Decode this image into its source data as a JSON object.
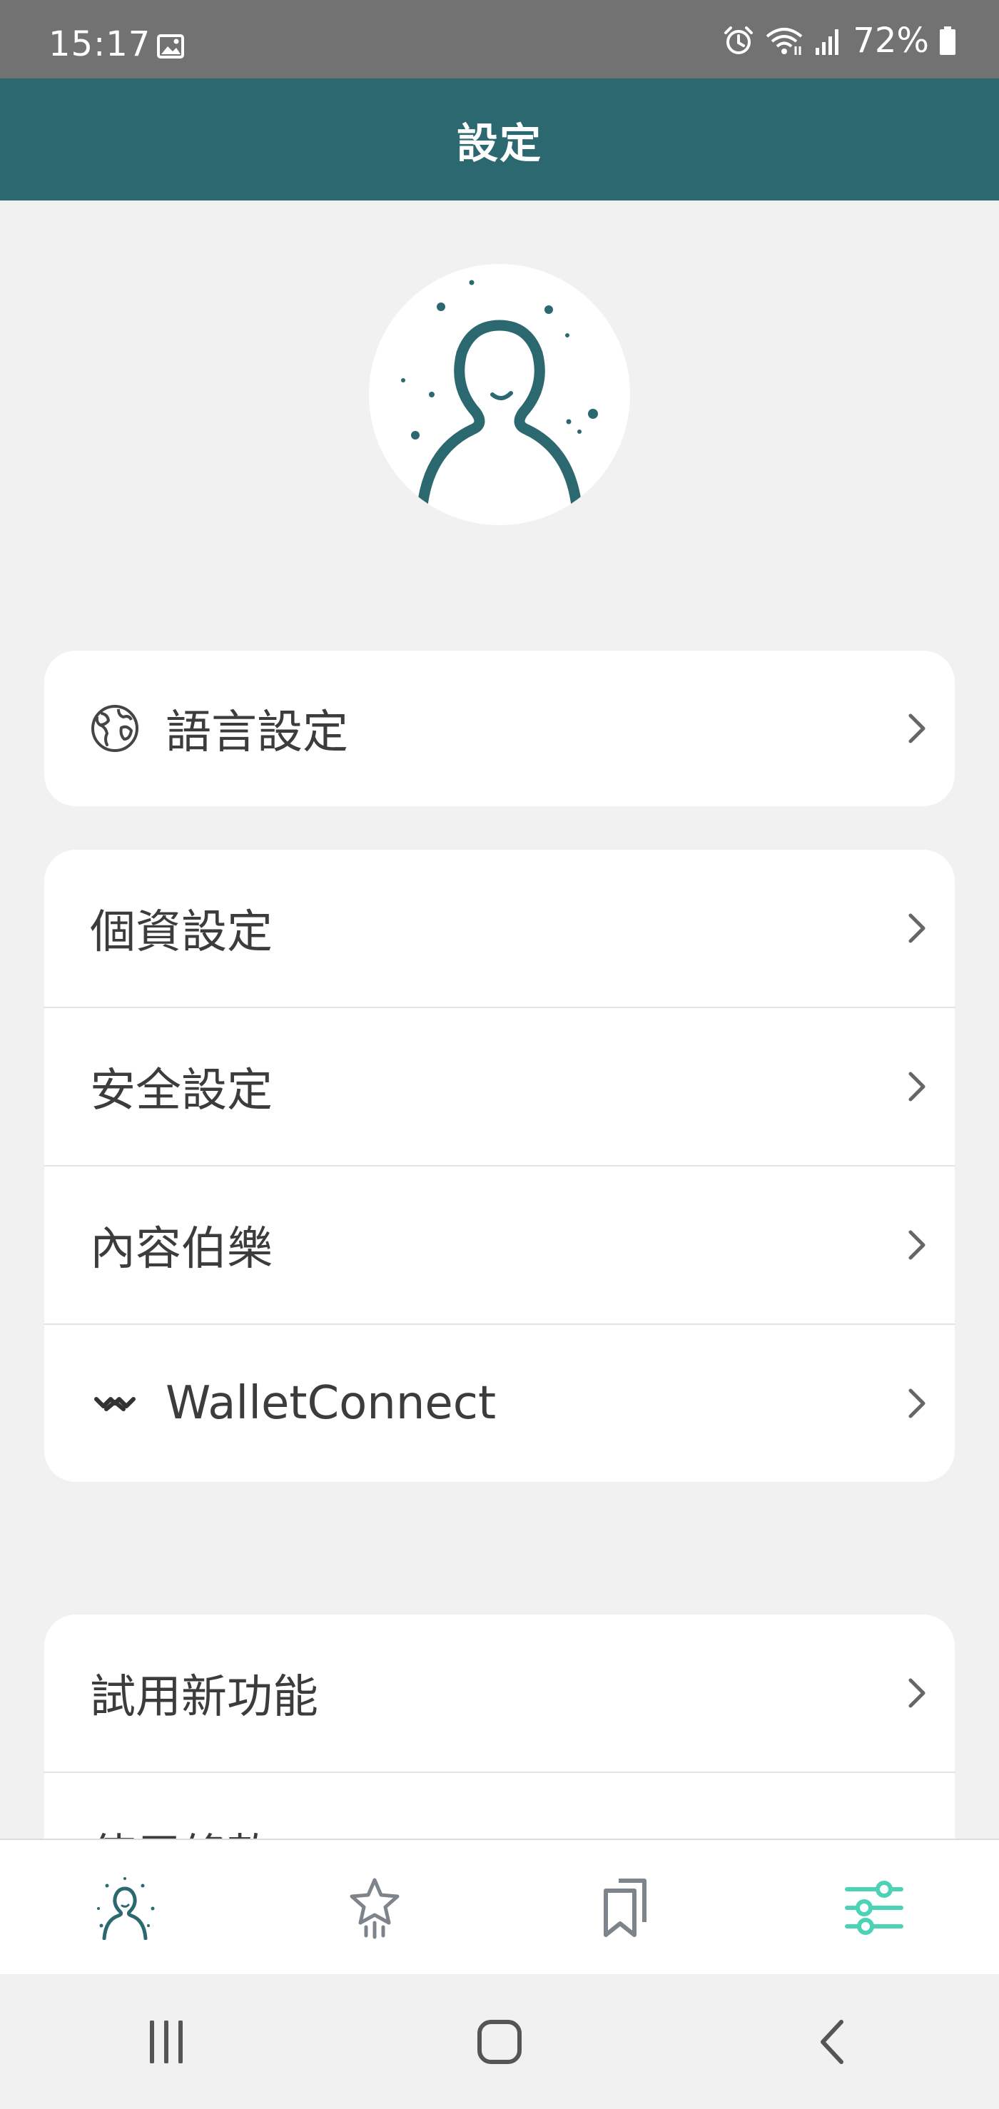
{
  "status_bar": {
    "time": "15:17",
    "battery": "72%",
    "icons": [
      "gallery-icon",
      "alarm-icon",
      "wifi-icon",
      "signal-icon",
      "battery-icon"
    ]
  },
  "header": {
    "title": "設定"
  },
  "settings": {
    "language": {
      "label": "語言設定",
      "icon": "globe-icon"
    },
    "group_account": [
      {
        "label": "個資設定"
      },
      {
        "label": "安全設定"
      },
      {
        "label": "內容伯樂"
      },
      {
        "label": "WalletConnect",
        "icon": "walletconnect-icon"
      }
    ],
    "group_more": [
      {
        "label": "試用新功能"
      },
      {
        "label": "使用條款"
      }
    ]
  },
  "bottom_nav": {
    "items": [
      {
        "name": "profile",
        "icon": "person-icon",
        "active": false
      },
      {
        "name": "favorites",
        "icon": "star-icon",
        "active": false
      },
      {
        "name": "bookmarks",
        "icon": "bookmarks-icon",
        "active": false
      },
      {
        "name": "settings",
        "icon": "sliders-icon",
        "active": true
      }
    ]
  },
  "colors": {
    "header_bg": "#2b6870",
    "accent_teal": "#4cd3b6",
    "icon_gray": "#7d848b",
    "avatar_stroke": "#2b6870",
    "status_bar_bg": "#727272",
    "page_bg": "#f1f1f1"
  }
}
